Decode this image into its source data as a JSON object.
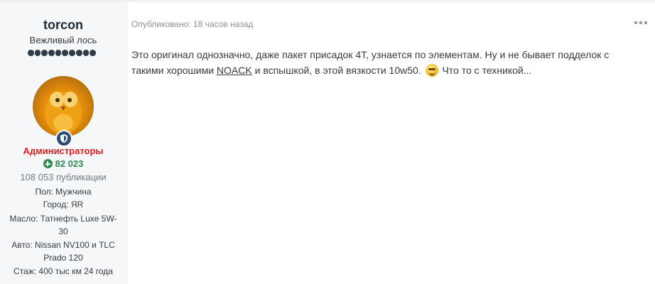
{
  "author": {
    "username": "torcon",
    "rank_title": "Вежливый лось",
    "rank_pips": 10,
    "group": "Администраторы",
    "reputation": "82 023",
    "posts": "108 053 публикации",
    "fields": [
      "Пол: Мужчина",
      "Город: ЯR",
      "Масло: Татнефть Luxe 5W-30",
      "Авто: Nissan NV100 и TLC Prado 120",
      "Стаж: 400 тыс км 24 года"
    ],
    "avatar_icon": "owl-avatar",
    "badge_icon": "moderator-shield-icon"
  },
  "post": {
    "meta": "Опубликовано: 18 часов назад",
    "body_part1": "Это оригинал однозначно, даже пакет присадок 4Т, узнается по элементам. Ну и не бывает подделок с такими хорошими ",
    "body_link": "NOACK",
    "body_part2": " и вспышкой, в этой вязкости 10w50.",
    "body_part3": " Что то с техникой...",
    "emoji_icon": "smiley-emoji-icon"
  },
  "colors": {
    "group": "#dc1e1e",
    "reputation": "#2f8a4f",
    "author_bg": "#f6f7f9"
  }
}
